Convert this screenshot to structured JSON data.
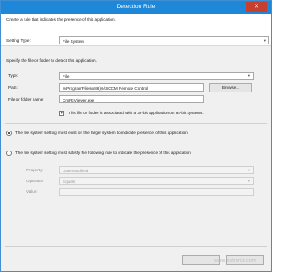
{
  "window": {
    "title": "Detection Rule",
    "close_glyph": "✕"
  },
  "header": {
    "description": "Create a rule that indicates the presence of this application.",
    "setting_type_label": "Setting Type:",
    "setting_type_value": "File System"
  },
  "file_group": {
    "description": "Specify the file or folder to detect this application.",
    "type_label": "Type:",
    "type_value": "File",
    "path_label": "Path:",
    "path_value": "%ProgramFiles(x86)%\\SCCM Remote Control",
    "browse_label": "Browse...",
    "name_label": "File or folder name:",
    "name_value": "CmRcViewer.exe",
    "checkbox_label": "This file or folder is associated with a 32-bit application on 64-bit systems.",
    "checkbox_checked": true
  },
  "rules": {
    "option1_label": "The file system setting must exist on the target system to indicate presence of this application",
    "option1_selected": true,
    "option2_label": "The file system setting must satisfy the following rule to indicate the presence of this application",
    "option2_selected": false,
    "property_label": "Property:",
    "property_value": "Date Modified",
    "operator_label": "Operator:",
    "operator_value": "Equals",
    "value_label": "Value:",
    "value_value": ""
  },
  "footer": {
    "ok_label": "",
    "cancel_label": ""
  },
  "watermark": "www.wstronic.com",
  "icons": {
    "chevron": "chevron-down-icon"
  },
  "colors": {
    "titlebar": "#1e87d8",
    "close": "#c7402f"
  }
}
